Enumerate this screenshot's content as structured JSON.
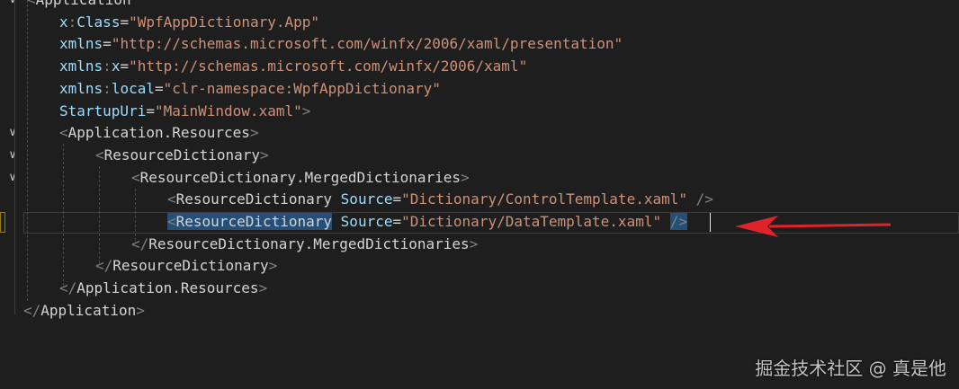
{
  "editor": {
    "lines": [
      {
        "tokens": [
          {
            "c": "p",
            "t": "<"
          },
          {
            "c": "el",
            "t": "Application"
          }
        ]
      },
      {
        "tokens": [
          {
            "c": "at",
            "t": "x"
          },
          {
            "c": "p",
            "t": ":"
          },
          {
            "c": "at",
            "t": "Class"
          },
          {
            "c": "eq",
            "t": "="
          },
          {
            "c": "st",
            "t": "\"WpfAppDictionary.App\""
          }
        ]
      },
      {
        "tokens": [
          {
            "c": "at",
            "t": "xmlns"
          },
          {
            "c": "eq",
            "t": "="
          },
          {
            "c": "st",
            "t": "\"http://schemas.microsoft.com/winfx/2006/xaml/presentation\""
          }
        ]
      },
      {
        "tokens": [
          {
            "c": "at",
            "t": "xmlns"
          },
          {
            "c": "p",
            "t": ":"
          },
          {
            "c": "at",
            "t": "x"
          },
          {
            "c": "eq",
            "t": "="
          },
          {
            "c": "st",
            "t": "\"http://schemas.microsoft.com/winfx/2006/xaml\""
          }
        ]
      },
      {
        "tokens": [
          {
            "c": "at",
            "t": "xmlns"
          },
          {
            "c": "p",
            "t": ":"
          },
          {
            "c": "at",
            "t": "local"
          },
          {
            "c": "eq",
            "t": "="
          },
          {
            "c": "st",
            "t": "\"clr-namespace:WpfAppDictionary\""
          }
        ]
      },
      {
        "tokens": [
          {
            "c": "at",
            "t": "StartupUri"
          },
          {
            "c": "eq",
            "t": "="
          },
          {
            "c": "st",
            "t": "\"MainWindow.xaml\""
          },
          {
            "c": "p",
            "t": ">"
          }
        ]
      },
      {
        "tokens": [
          {
            "c": "p",
            "t": "<"
          },
          {
            "c": "el",
            "t": "Application.Resources"
          },
          {
            "c": "p",
            "t": ">"
          }
        ]
      },
      {
        "tokens": [
          {
            "c": "p",
            "t": "<"
          },
          {
            "c": "el",
            "t": "ResourceDictionary"
          },
          {
            "c": "p",
            "t": ">"
          }
        ]
      },
      {
        "tokens": [
          {
            "c": "p",
            "t": "<"
          },
          {
            "c": "el",
            "t": "ResourceDictionary.MergedDictionaries"
          },
          {
            "c": "p",
            "t": ">"
          }
        ]
      },
      {
        "tokens": [
          {
            "c": "p",
            "t": "<"
          },
          {
            "c": "el",
            "t": "ResourceDictionary"
          },
          {
            "c": "eq",
            "t": " "
          },
          {
            "c": "at",
            "t": "Source"
          },
          {
            "c": "eq",
            "t": "="
          },
          {
            "c": "st",
            "t": "\"Dictionary/ControlTemplate.xaml\""
          },
          {
            "c": "eq",
            "t": " "
          },
          {
            "c": "p",
            "t": "/>"
          }
        ]
      },
      {
        "tokens": [
          {
            "c": "p sel",
            "t": "<"
          },
          {
            "c": "el sel",
            "t": "ResourceDictionary"
          },
          {
            "c": "eq",
            "t": " "
          },
          {
            "c": "at",
            "t": "Source"
          },
          {
            "c": "eq",
            "t": "="
          },
          {
            "c": "st",
            "t": "\"Dictionary/DataTemplate.xaml\""
          },
          {
            "c": "eq",
            "t": " "
          },
          {
            "c": "p sel",
            "t": "/>"
          }
        ]
      },
      {
        "tokens": [
          {
            "c": "p",
            "t": "</"
          },
          {
            "c": "el",
            "t": "ResourceDictionary.MergedDictionaries"
          },
          {
            "c": "p",
            "t": ">"
          }
        ]
      },
      {
        "tokens": [
          {
            "c": "p",
            "t": "</"
          },
          {
            "c": "el",
            "t": "ResourceDictionary"
          },
          {
            "c": "p",
            "t": ">"
          }
        ]
      },
      {
        "tokens": [
          {
            "c": "p",
            "t": "</"
          },
          {
            "c": "el",
            "t": "Application.Resources"
          },
          {
            "c": "p",
            "t": ">"
          }
        ]
      },
      {
        "tokens": [
          {
            "c": "p",
            "t": "</"
          },
          {
            "c": "el",
            "t": "Application"
          },
          {
            "c": "p",
            "t": ">"
          }
        ]
      }
    ]
  },
  "watermark": {
    "text": "掘金技术社区 @ 真是他"
  },
  "colors": {
    "background": "#1e1e1e",
    "tag_bracket": "#808080",
    "element": "#d4d4d4",
    "attribute": "#9cdcfe",
    "string": "#ce9178",
    "selection": "#264f78",
    "arrow": "#e0222a"
  }
}
